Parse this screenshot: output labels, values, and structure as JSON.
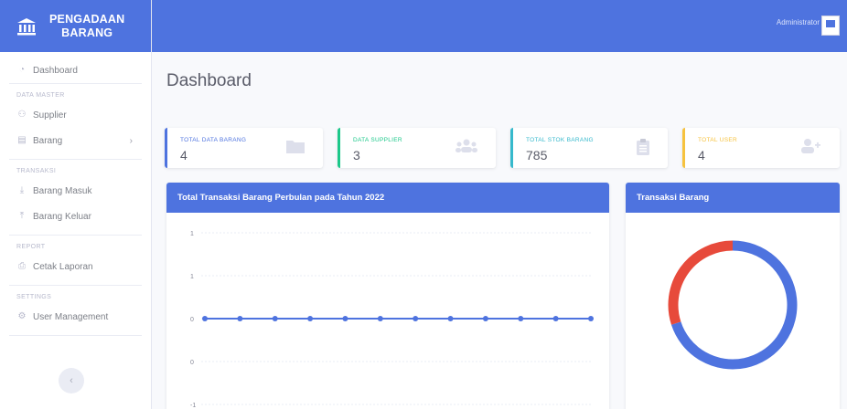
{
  "brand": {
    "line1": "PENGADAAN",
    "line2": "BARANG"
  },
  "sidebar": {
    "dashboard": "Dashboard",
    "heading_master": "DATA MASTER",
    "supplier": "Supplier",
    "barang": "Barang",
    "heading_transaksi": "TRANSAKSI",
    "barang_masuk": "Barang Masuk",
    "barang_keluar": "Barang Keluar",
    "heading_report": "REPORT",
    "cetak_laporan": "Cetak Laporan",
    "heading_settings": "SETTINGS",
    "user_management": "User Management"
  },
  "topbar": {
    "user": "Administrator"
  },
  "page": {
    "title": "Dashboard"
  },
  "cards": [
    {
      "label": "TOTAL DATA BARANG",
      "value": "4",
      "color": "#4e73df",
      "icon": "folder-icon"
    },
    {
      "label": "DATA SUPPLIER",
      "value": "3",
      "color": "#1cc88a",
      "icon": "users-icon"
    },
    {
      "label": "TOTAL STOK BARANG",
      "value": "785",
      "color": "#36b9cc",
      "icon": "clipboard-icon"
    },
    {
      "label": "TOTAL USER",
      "value": "4",
      "color": "#f6c23e",
      "icon": "user-plus-icon"
    }
  ],
  "line_panel": {
    "title": "Total Transaksi Barang Perbulan pada Tahun 2022"
  },
  "donut_panel": {
    "title": "Transaksi Barang"
  },
  "chart_data": [
    {
      "type": "line",
      "title": "Total Transaksi Barang Perbulan pada Tahun 2022",
      "y_ticks": [
        "1",
        "1",
        "0",
        "0",
        "-1"
      ],
      "ylim": [
        -1,
        1
      ],
      "series": [
        {
          "values": [
            0,
            0,
            0,
            0,
            0,
            0,
            0,
            0,
            0,
            0,
            0,
            0
          ]
        }
      ],
      "color": "#4e73df",
      "grid": true
    },
    {
      "type": "pie",
      "title": "Transaksi Barang",
      "values": [
        70,
        30
      ],
      "colors": [
        "#4e73df",
        "#e74a3b"
      ]
    }
  ]
}
